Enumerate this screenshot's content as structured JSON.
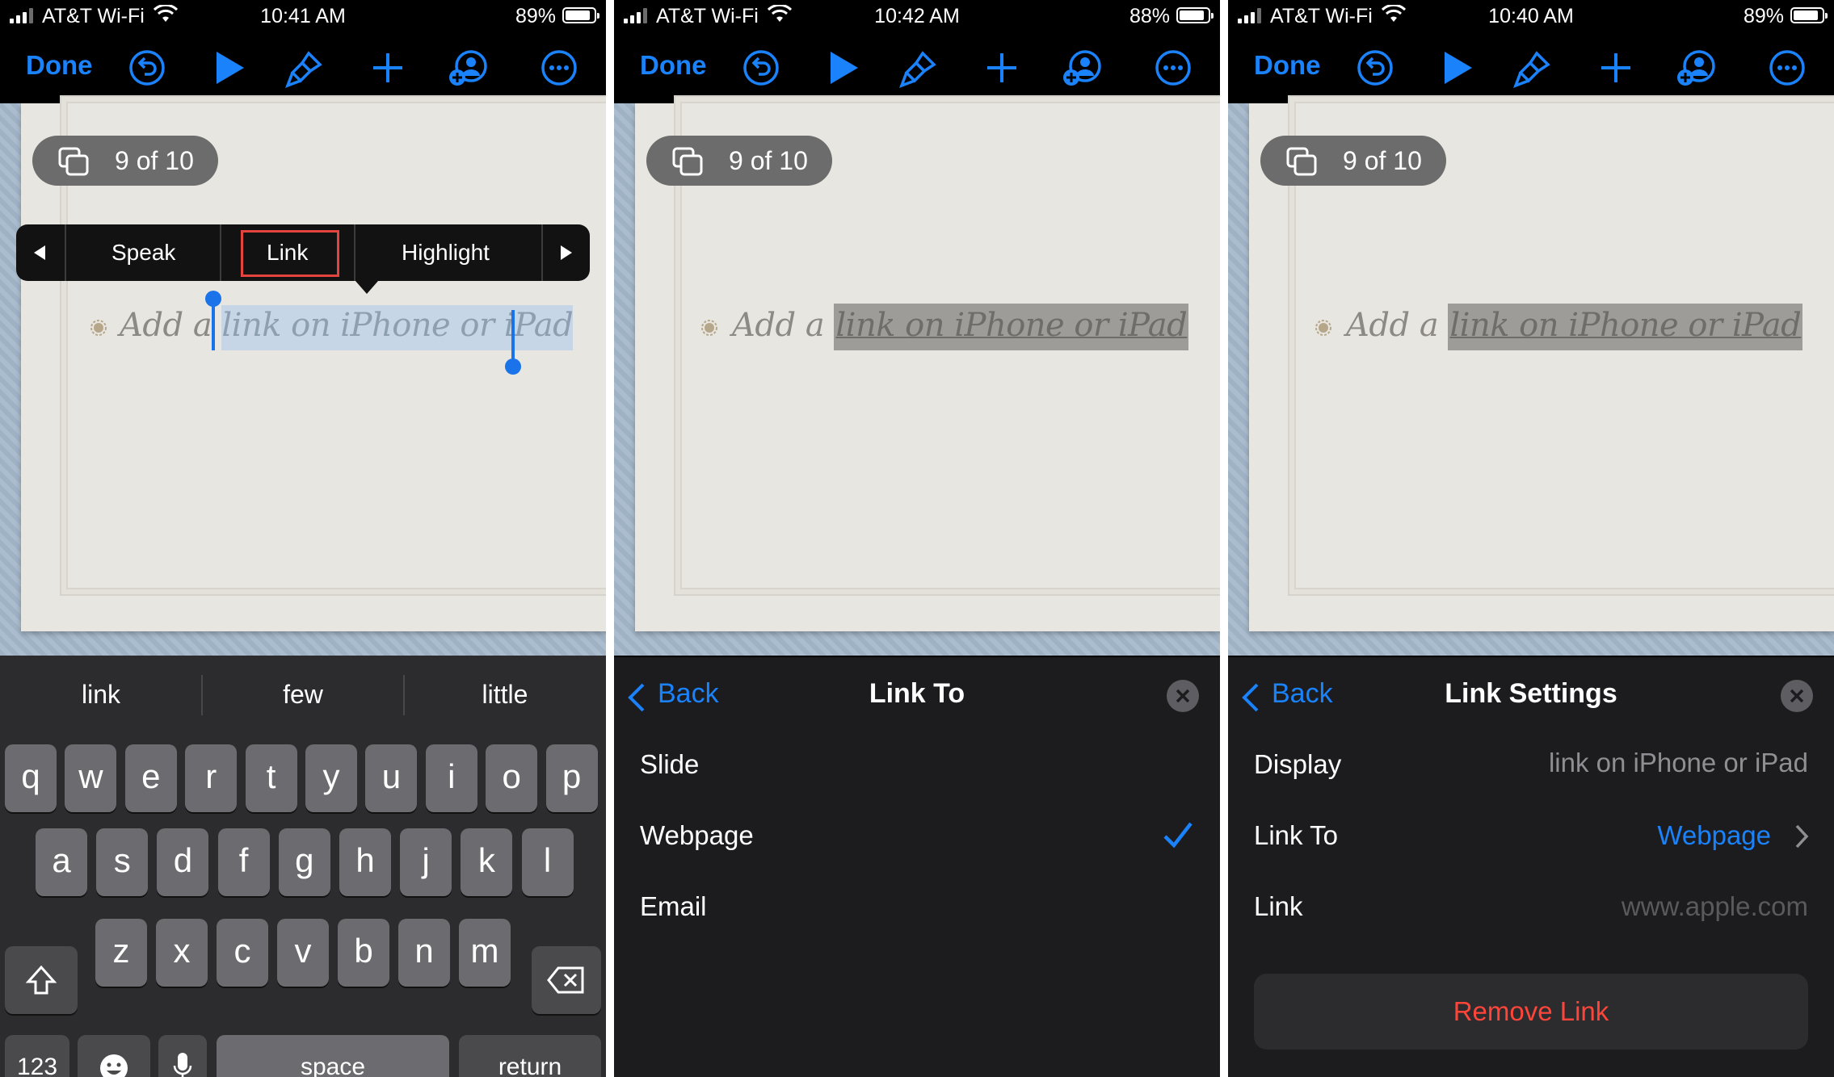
{
  "status_bars": [
    {
      "carrier": "AT&T Wi-Fi",
      "time": "10:41 AM",
      "battery": "89%"
    },
    {
      "carrier": "AT&T Wi-Fi",
      "time": "10:42 AM",
      "battery": "88%"
    },
    {
      "carrier": "AT&T Wi-Fi",
      "time": "10:40 AM",
      "battery": "89%"
    }
  ],
  "toolbar": {
    "done_label": "Done",
    "icons": [
      "undo-icon",
      "play-icon",
      "paintbrush-icon",
      "plus-icon",
      "add-collaborator-icon",
      "more-icon"
    ],
    "accent": "#1a82fb"
  },
  "slide": {
    "counter": "9 of 10",
    "text_prefix": "Add a ",
    "text_link": "link on iPhone or iPad"
  },
  "edit_menu": {
    "items": [
      "Speak",
      "Link",
      "Highlight"
    ],
    "highlight_box_color": "#e3443d"
  },
  "keyboard": {
    "suggestions": [
      "link",
      "few",
      "little"
    ],
    "row1": [
      "q",
      "w",
      "e",
      "r",
      "t",
      "y",
      "u",
      "i",
      "o",
      "p"
    ],
    "row2": [
      "a",
      "s",
      "d",
      "f",
      "g",
      "h",
      "j",
      "k",
      "l"
    ],
    "row3": [
      "z",
      "x",
      "c",
      "v",
      "b",
      "n",
      "m"
    ],
    "numbers_label": "123",
    "space_label": "space",
    "return_label": "return"
  },
  "link_to_sheet": {
    "back_label": "Back",
    "title": "Link To",
    "options": [
      "Slide",
      "Webpage",
      "Email"
    ],
    "selected": "Webpage"
  },
  "link_settings_sheet": {
    "back_label": "Back",
    "title": "Link Settings",
    "display_label": "Display",
    "display_value": "link on iPhone or iPad",
    "link_to_label": "Link To",
    "link_to_value": "Webpage",
    "link_label": "Link",
    "link_placeholder": "www.apple.com",
    "remove_label": "Remove Link",
    "remove_color": "#ff453a"
  }
}
